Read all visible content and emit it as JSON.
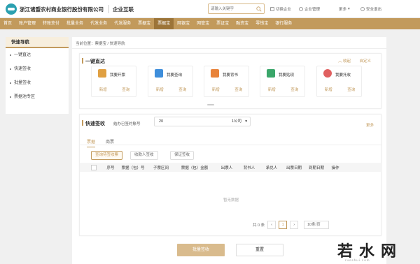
{
  "header": {
    "bank_name": "浙江诸暨农村商业银行股份有限公司",
    "product_name": "企业互联",
    "search_placeholder": "请输入关键字",
    "switch_company": "切换企业",
    "enterprise_mgmt": "企业管理",
    "more": "更多",
    "logout": "安全退出"
  },
  "nav": {
    "items": [
      "首页",
      "账户管理",
      "转账支付",
      "批量业务",
      "代发业务",
      "代发服务",
      "票据宝",
      "票据宝",
      "网银宝",
      "网管宝",
      "票证宝",
      "融资宝",
      "零钱宝",
      "银行服务"
    ]
  },
  "sidebar": {
    "title": "快速导航",
    "items": [
      "一键直达",
      "快速签收",
      "批量签收",
      "票据池专区"
    ]
  },
  "breadcrumb": {
    "text": "当前位置：票据宝  /  快速导航"
  },
  "direct": {
    "title": "一键直达",
    "collapse": "收起",
    "settings": "自定义",
    "cards": [
      {
        "title": "我要开票",
        "a1": "新增",
        "a2": "查询",
        "color": "#e0a042"
      },
      {
        "title": "我要查询",
        "a1": "新增",
        "a2": "查询",
        "color": "#3e8edb"
      },
      {
        "title": "我要背书",
        "a1": "新增",
        "a2": "查询",
        "color": "#e8833a"
      },
      {
        "title": "我要贴现",
        "a1": "新增",
        "a2": "查询",
        "color": "#3aa66a"
      },
      {
        "title": "我要托收",
        "a1": "新增",
        "a2": "查询",
        "color": "#e06060"
      }
    ]
  },
  "quick_sign": {
    "title": "快速签收",
    "account_label": "结办已签约账号",
    "account_value": "20",
    "account_suffix": "1公司",
    "more": "更多",
    "tabs": [
      "票据",
      "商票"
    ],
    "filters": [
      "查询待签收票",
      "收款人签收",
      "保证签收"
    ],
    "columns": [
      "序号",
      "票据（包）号",
      "子票区间",
      "票据（包）金额",
      "出票人",
      "背书人",
      "承兑人",
      "出票日期",
      "到期日期",
      "操作"
    ],
    "empty_text": "暂无数据",
    "pager_total": "共 0 条",
    "page_current": "1",
    "page_size": "10条/页",
    "confirm_btn": "批量签收",
    "reset_btn": "重置"
  },
  "watermark": {
    "text": "若水网",
    "sub": "ruoshui.com"
  }
}
